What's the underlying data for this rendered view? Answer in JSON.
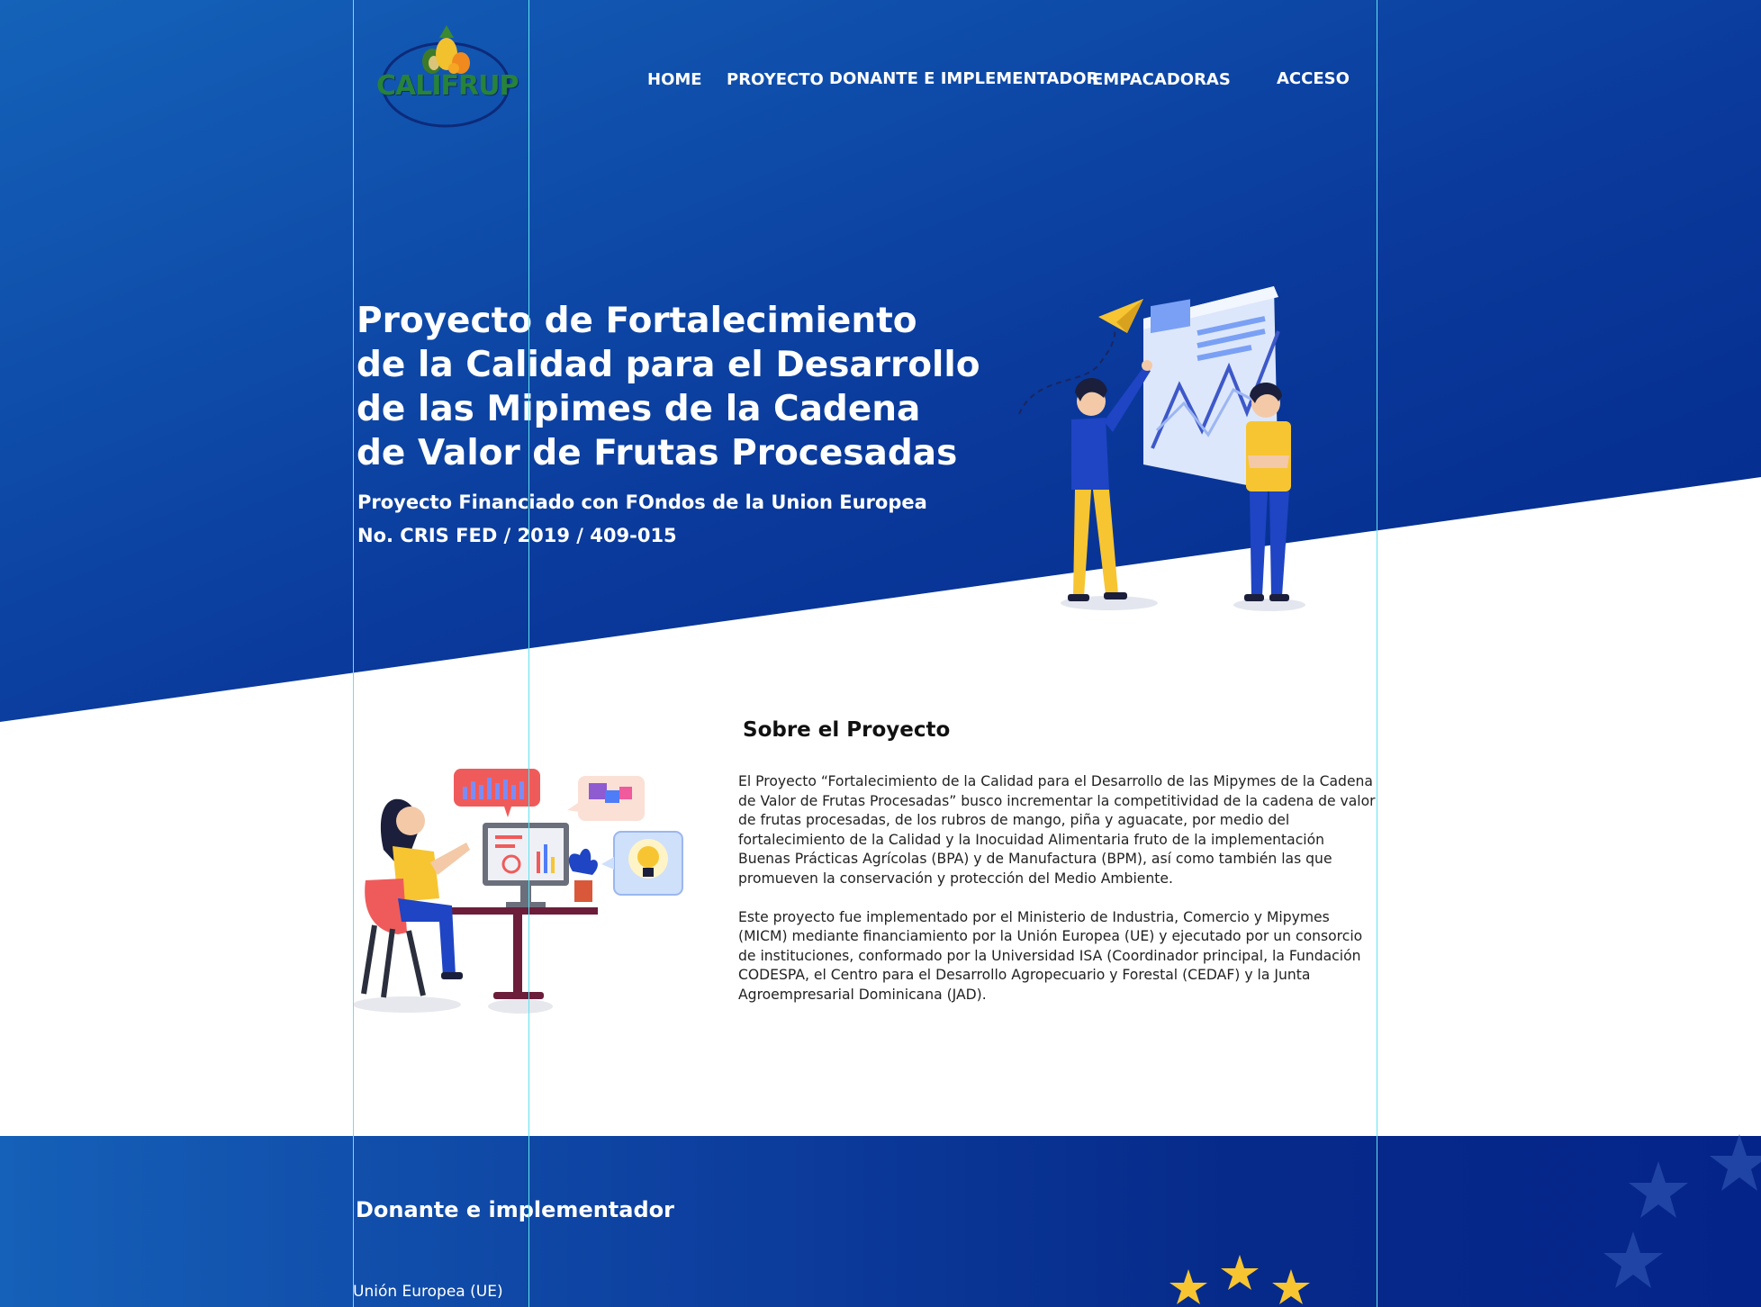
{
  "brand": {
    "logo_text": "CALIFRUP"
  },
  "nav": {
    "items": [
      {
        "label": "HOME"
      },
      {
        "label": "PROYECTO"
      },
      {
        "label": "DONANTE E IMPLEMENTADOR"
      },
      {
        "label": "EMPACADORAS"
      },
      {
        "label": "ACCESO"
      }
    ]
  },
  "hero": {
    "title_lines": [
      "Proyecto de Fortalecimiento",
      "de la Calidad para el Desarrollo",
      "de las Mipimes de la Cadena",
      "de Valor de Frutas Procesadas"
    ],
    "subtitle_lines": [
      "Proyecto Financiado con FOndos de la Union Europea",
      "No. CRIS FED / 2019 / 409-015"
    ]
  },
  "about": {
    "title": "Sobre el Proyecto",
    "paragraphs": [
      "El Proyecto “Fortalecimiento de la Calidad para el Desarrollo de las Mipymes de la Cadena de Valor de Frutas Procesadas” busco incrementar la competitividad de la cadena de valor de frutas procesadas, de los rubros de mango, piña y aguacate, por medio del fortalecimiento de la Calidad y la Inocuidad Alimentaria fruto de la implementación Buenas Prácticas Agrícolas (BPA) y de Manufactura (BPM), así como también las que promueven la conservación y protección del Medio Ambiente.",
      "Este proyecto fue implementado por el Ministerio de Industria, Comercio y Mipymes (MICM) mediante financiamiento por la Unión Europea (UE) y ejecutado por un consorcio de instituciones, conformado por la Universidad ISA (Coordinador principal, la Fundación CODESPA, el Centro para el Desarrollo Agropecuario y Forestal (CEDAF) y la Junta Agroempresarial Dominicana (JAD)."
    ]
  },
  "donante": {
    "title": "Donante e implementador",
    "label": "Unión Europea (UE)"
  },
  "colors": {
    "hero_blue_top": "#1560b8",
    "hero_blue_bottom": "#032c8e",
    "accent_yellow": "#f7c531",
    "guide_cyan": "#5fe3f0"
  }
}
